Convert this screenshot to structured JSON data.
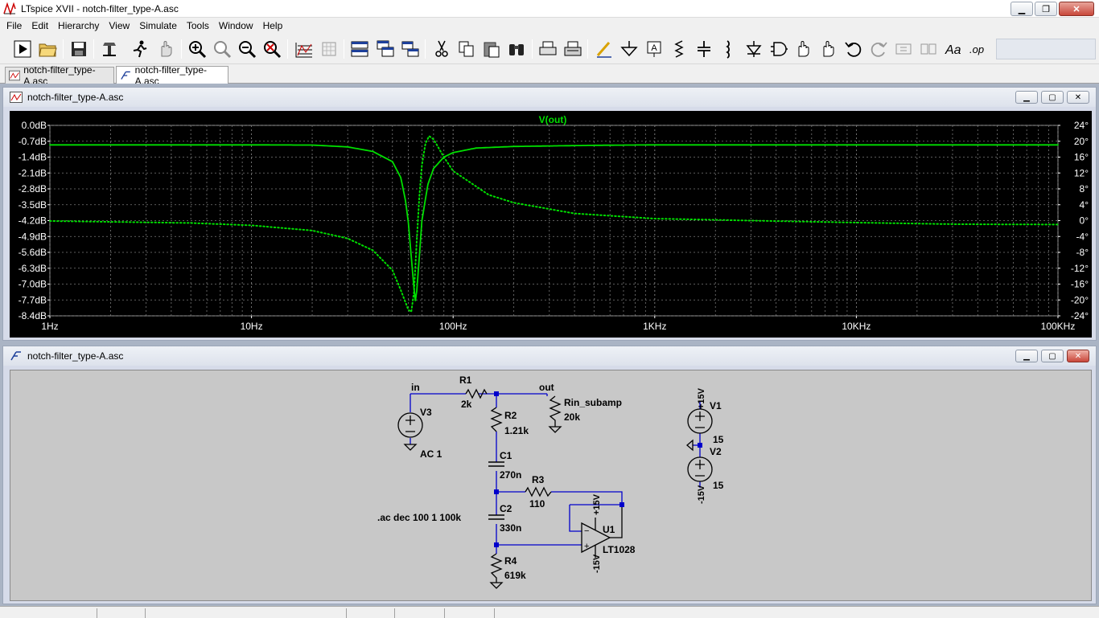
{
  "window": {
    "title": "LTspice XVII - notch-filter_type-A.asc"
  },
  "menu": [
    "File",
    "Edit",
    "Hierarchy",
    "View",
    "Simulate",
    "Tools",
    "Window",
    "Help"
  ],
  "toolbar_icons": [
    "run-icon",
    "open-icon",
    "save-icon",
    "control-panel-icon",
    "halt-icon",
    "pan-icon",
    "zoom-in-icon",
    "zoom-area-icon",
    "zoom-out-icon",
    "zoom-fit-icon",
    "autorange-icon",
    "grid-icon",
    "tile-horizontal-icon",
    "cascade-icon",
    "tile-vertical-icon",
    "cut-icon",
    "copy-icon",
    "paste-icon",
    "find-icon",
    "print-icon",
    "print-setup-icon",
    "draw-wire-icon",
    "ground-icon",
    "label-net-icon",
    "resistor-icon",
    "capacitor-icon",
    "inductor-icon",
    "diode-icon",
    "component-icon",
    "move-icon",
    "drag-icon",
    "undo-icon",
    "redo-icon",
    "rotate-icon",
    "mirror-icon",
    "text-icon",
    "spice-directive-icon"
  ],
  "tabs": [
    {
      "label": "notch-filter_type-A.asc",
      "icon": "waveform-icon"
    },
    {
      "label": "notch-filter_type-A.asc",
      "icon": "schematic-icon"
    }
  ],
  "plot_window": {
    "title": "notch-filter_type-A.asc"
  },
  "schematic_window": {
    "title": "notch-filter_type-A.asc"
  },
  "colors": {
    "trace": "#00e000",
    "grid": "#808080",
    "wire": "#0000cc",
    "schem_bg": "#c8c8c8"
  },
  "chart_data": {
    "type": "line",
    "title": "V(out)",
    "x_scale": "log",
    "xlim": [
      1,
      100000
    ],
    "x_ticks": [
      "1Hz",
      "10Hz",
      "100Hz",
      "1KHz",
      "10KHz",
      "100KHz"
    ],
    "ylim": [
      -8.4,
      0.0
    ],
    "y_ticks_left": [
      "0.0dB",
      "-0.7dB",
      "-1.4dB",
      "-2.1dB",
      "-2.8dB",
      "-3.5dB",
      "-4.2dB",
      "-4.9dB",
      "-5.6dB",
      "-6.3dB",
      "-7.0dB",
      "-7.7dB",
      "-8.4dB"
    ],
    "y2lim": [
      -24,
      24
    ],
    "y_ticks_right": [
      "24°",
      "20°",
      "16°",
      "12°",
      "8°",
      "4°",
      "0°",
      "-4°",
      "-8°",
      "-12°",
      "-16°",
      "-20°",
      "-24°"
    ],
    "grid": true,
    "series": [
      {
        "name": "magnitude",
        "style": "solid",
        "axis": "left",
        "points": [
          [
            1,
            -0.86
          ],
          [
            10,
            -0.86
          ],
          [
            20,
            -0.87
          ],
          [
            30,
            -0.95
          ],
          [
            40,
            -1.15
          ],
          [
            50,
            -1.6
          ],
          [
            55,
            -2.3
          ],
          [
            58,
            -3.3
          ],
          [
            60,
            -4.3
          ],
          [
            62,
            -5.8
          ],
          [
            64,
            -7.2
          ],
          [
            65,
            -7.75
          ],
          [
            66,
            -7.3
          ],
          [
            68,
            -5.8
          ],
          [
            70,
            -4.2
          ],
          [
            75,
            -2.6
          ],
          [
            80,
            -1.9
          ],
          [
            90,
            -1.4
          ],
          [
            100,
            -1.2
          ],
          [
            130,
            -1.0
          ],
          [
            200,
            -0.93
          ],
          [
            500,
            -0.88
          ],
          [
            1000,
            -0.86
          ],
          [
            100000,
            -0.86
          ]
        ]
      },
      {
        "name": "phase",
        "style": "dotted",
        "axis": "right",
        "points": [
          [
            1,
            -0.1
          ],
          [
            5,
            -0.6
          ],
          [
            10,
            -1.2
          ],
          [
            20,
            -2.5
          ],
          [
            30,
            -4.5
          ],
          [
            40,
            -7.5
          ],
          [
            50,
            -12.5
          ],
          [
            55,
            -17.5
          ],
          [
            60,
            -22.5
          ],
          [
            62,
            -23.0
          ],
          [
            64,
            -18
          ],
          [
            66,
            -5
          ],
          [
            68,
            6
          ],
          [
            70,
            14
          ],
          [
            73,
            19.5
          ],
          [
            76,
            21.3
          ],
          [
            80,
            20.5
          ],
          [
            90,
            16
          ],
          [
            100,
            12.5
          ],
          [
            150,
            6.5
          ],
          [
            200,
            4.5
          ],
          [
            400,
            1.8
          ],
          [
            1000,
            0.5
          ],
          [
            3000,
            0
          ],
          [
            10000,
            -0.5
          ],
          [
            30000,
            -0.9
          ],
          [
            100000,
            -1.0
          ]
        ]
      }
    ]
  },
  "schematic": {
    "labels": {
      "in": "in",
      "out": "out",
      "R1": "R1",
      "R1_val": "2k",
      "R2": "R2",
      "R2_val": "1.21k",
      "R3": "R3",
      "R3_val": "110",
      "R4": "R4",
      "R4_val": "619k",
      "C1": "C1",
      "C1_val": "270n",
      "C2": "C2",
      "C2_val": "330n",
      "Rload": "Rin_subamp",
      "Rload_val": "20k",
      "V3": "V3",
      "V3_val": "AC 1",
      "V1": "V1",
      "V1_val": "15",
      "V2": "V2",
      "V2_val": "15",
      "U1": "U1",
      "U1_val": "LT1028",
      "pos15": "+15V",
      "neg15": "-15V",
      "directive": ".ac dec 100 1 100k"
    }
  }
}
